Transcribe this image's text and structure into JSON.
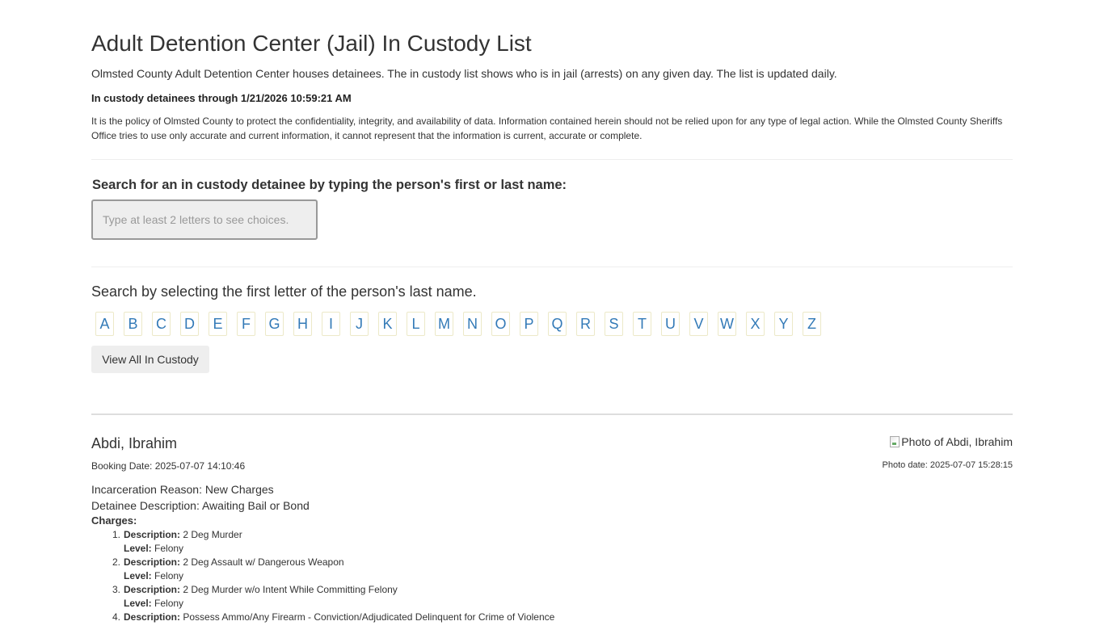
{
  "header": {
    "title": "Adult Detention Center (Jail) In Custody List",
    "intro": "Olmsted County Adult Detention Center houses detainees. The in custody list shows who is in jail (arrests) on any given day.  The list is updated daily.",
    "through": "In custody detainees through 1/21/2026 10:59:21 AM",
    "policy": "It is the policy of Olmsted County to protect the confidentiality, integrity, and availability of data. Information contained herein should not be relied upon for any type of legal action. While the Olmsted County Sheriffs Office tries to use only accurate and current information, it cannot represent that the information is current, accurate or complete."
  },
  "search": {
    "label": "Search for an in custody detainee by typing the person's first or last name:",
    "placeholder": "Type at least 2 letters to see choices."
  },
  "letter_search": {
    "label": "Search by selecting the first letter of the person's last name.",
    "letters": [
      "A",
      "B",
      "C",
      "D",
      "E",
      "F",
      "G",
      "H",
      "I",
      "J",
      "K",
      "L",
      "M",
      "N",
      "O",
      "P",
      "Q",
      "R",
      "S",
      "T",
      "U",
      "V",
      "W",
      "X",
      "Y",
      "Z"
    ],
    "view_all": "View All In Custody"
  },
  "detainee": {
    "name": "Abdi, Ibrahim",
    "booking_date": "Booking Date: 2025-07-07 14:10:46",
    "photo_alt": "Photo of Abdi, Ibrahim",
    "photo_date": "Photo date: 2025-07-07 15:28:15",
    "incarceration_reason": "Incarceration Reason: New Charges",
    "detainee_description": "Detainee Description: Awaiting Bail or Bond",
    "charges_label": "Charges:",
    "description_label": "Description:",
    "level_label": "Level:",
    "charges": [
      {
        "num": "1.",
        "description": "2 Deg Murder",
        "level": "Felony"
      },
      {
        "num": "2.",
        "description": "2 Deg Assault w/ Dangerous Weapon",
        "level": "Felony"
      },
      {
        "num": "3.",
        "description": "2 Deg Murder w/o Intent While Committing Felony",
        "level": "Felony"
      },
      {
        "num": "4.",
        "description": "Possess Ammo/Any Firearm - Conviction/Adjudicated Delinquent for Crime of Violence",
        "level": ""
      }
    ]
  }
}
